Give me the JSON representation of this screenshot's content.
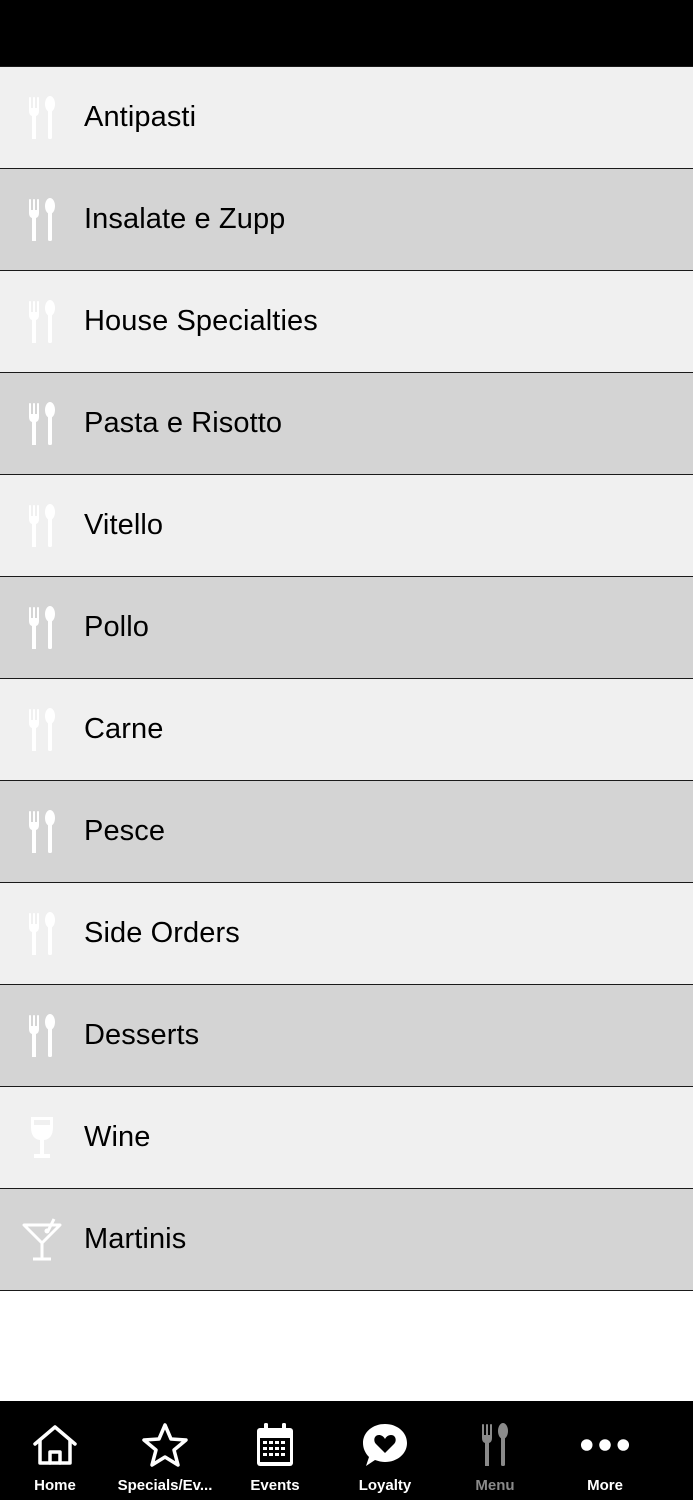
{
  "menu_items": [
    {
      "label": "Antipasti",
      "icon": "fork-spoon-icon"
    },
    {
      "label": "Insalate e Zupp",
      "icon": "fork-spoon-icon"
    },
    {
      "label": "House Specialties",
      "icon": "fork-spoon-icon"
    },
    {
      "label": "Pasta e Risotto",
      "icon": "fork-spoon-icon"
    },
    {
      "label": "Vitello",
      "icon": "fork-spoon-icon"
    },
    {
      "label": "Pollo",
      "icon": "fork-spoon-icon"
    },
    {
      "label": "Carne",
      "icon": "fork-spoon-icon"
    },
    {
      "label": "Pesce",
      "icon": "fork-spoon-icon"
    },
    {
      "label": "Side Orders",
      "icon": "fork-spoon-icon"
    },
    {
      "label": "Desserts",
      "icon": "fork-spoon-icon"
    },
    {
      "label": "Wine",
      "icon": "wine-glass-icon"
    },
    {
      "label": "Martinis",
      "icon": "martini-glass-icon"
    }
  ],
  "tab_bar": {
    "tabs": [
      {
        "label": "Home",
        "icon": "home-icon"
      },
      {
        "label": "Specials/Ev...",
        "icon": "star-icon"
      },
      {
        "label": "Events",
        "icon": "calendar-icon"
      },
      {
        "label": "Loyalty",
        "icon": "heart-bubble-icon"
      },
      {
        "label": "Menu",
        "icon": "fork-spoon-icon",
        "selected": true
      },
      {
        "label": "More",
        "icon": "more-dots-icon"
      }
    ]
  },
  "colors": {
    "row_light": "#f0f0f0",
    "row_dark": "#d4d4d4",
    "bar_background": "#000000",
    "icon_white": "#ffffff",
    "tab_inactive": "#8a8a8a"
  }
}
